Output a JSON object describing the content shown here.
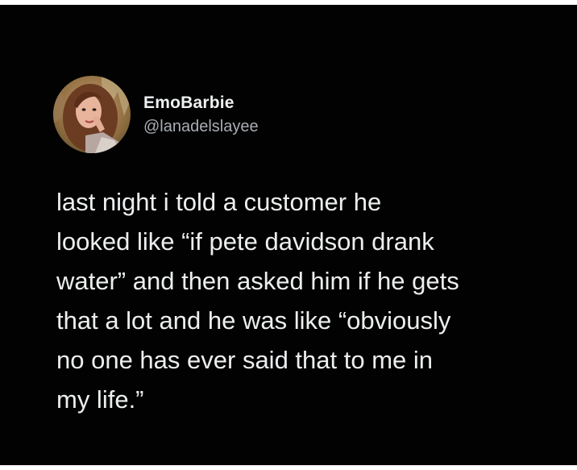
{
  "tweet": {
    "display_name": "EmoBarbie",
    "handle": "@lanadelslayee",
    "avatar_icon": "profile-photo",
    "lines": [
      "last night i told a customer he",
      "looked like “if pete davidson drank",
      "water” and then asked him if he gets",
      "that a lot and he was like “obviously",
      "no one has ever said that to me in",
      "my life.”"
    ]
  },
  "colors": {
    "background": "#020202",
    "text": "#eceeef",
    "secondary_text": "#a8adb3"
  }
}
